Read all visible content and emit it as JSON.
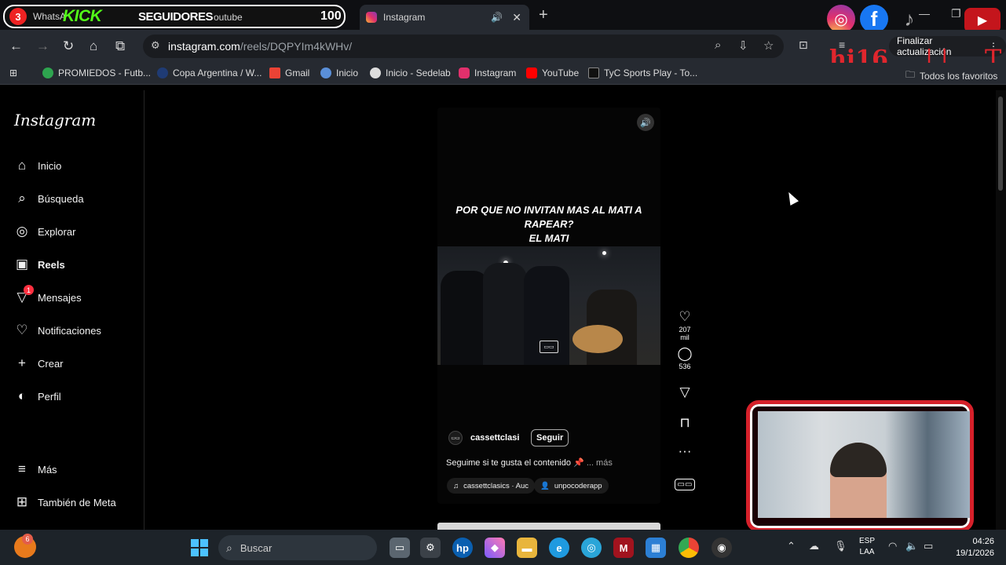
{
  "browser": {
    "tabs": [
      {
        "label": "WhatsA",
        "badge": "3"
      },
      {
        "label": "outube"
      },
      {
        "label": "Instagram"
      }
    ],
    "overlay_kick": "KICK",
    "overlay_followers": "SEGUIDORES",
    "overlay_count": "100",
    "url_host": "instagram.com",
    "url_path": "/reels/DQPYIm4kWHv/",
    "update_label": "Finalizar actualización",
    "bookmarks": [
      "PROMIEDOS - Futb...",
      "Copa Argentina / W...",
      "Gmail",
      "Inicio",
      "Inicio - Sedelab",
      "Instagram",
      "YouTube",
      "TyC Sports Play - To...",
      "Todos los favoritos"
    ],
    "stream_overlay_text": "hi16"
  },
  "sidebar": {
    "logo": "Instagram",
    "items": [
      {
        "label": "Inicio",
        "icon": "home-icon"
      },
      {
        "label": "Búsqueda",
        "icon": "search-icon"
      },
      {
        "label": "Explorar",
        "icon": "compass-icon"
      },
      {
        "label": "Reels",
        "icon": "reels-icon"
      },
      {
        "label": "Mensajes",
        "icon": "messages-icon",
        "badge": "1"
      },
      {
        "label": "Notificaciones",
        "icon": "heart-icon"
      },
      {
        "label": "Crear",
        "icon": "plus-icon"
      },
      {
        "label": "Perfil",
        "icon": "profile-icon"
      }
    ],
    "bottom": [
      {
        "label": "Más",
        "icon": "menu-icon"
      },
      {
        "label": "También de Meta",
        "icon": "meta-icon"
      }
    ]
  },
  "reel": {
    "caption_line1": "POR QUE NO INVITAN MAS AL MATI A RAPEAR?",
    "caption_line2": "EL MATI",
    "username": "cassettclasi",
    "follow_label": "Seguir",
    "description": "Seguime si te gusta el contenido 📌",
    "more_label": "... más",
    "audio_chip": "cassettclasics · Auc",
    "collab_chip": "unpocoderapp",
    "likes": "207 mil",
    "comments": "536"
  },
  "taskbar": {
    "weather_badge": "6",
    "search_placeholder": "Buscar",
    "lang_line1": "ESP",
    "lang_line2": "LAA",
    "time": "04:26",
    "date": "19/1/2026"
  },
  "colors": {
    "accent_red": "#d6202a",
    "kick_green": "#53fc18",
    "ig_badge": "#ff3040"
  }
}
